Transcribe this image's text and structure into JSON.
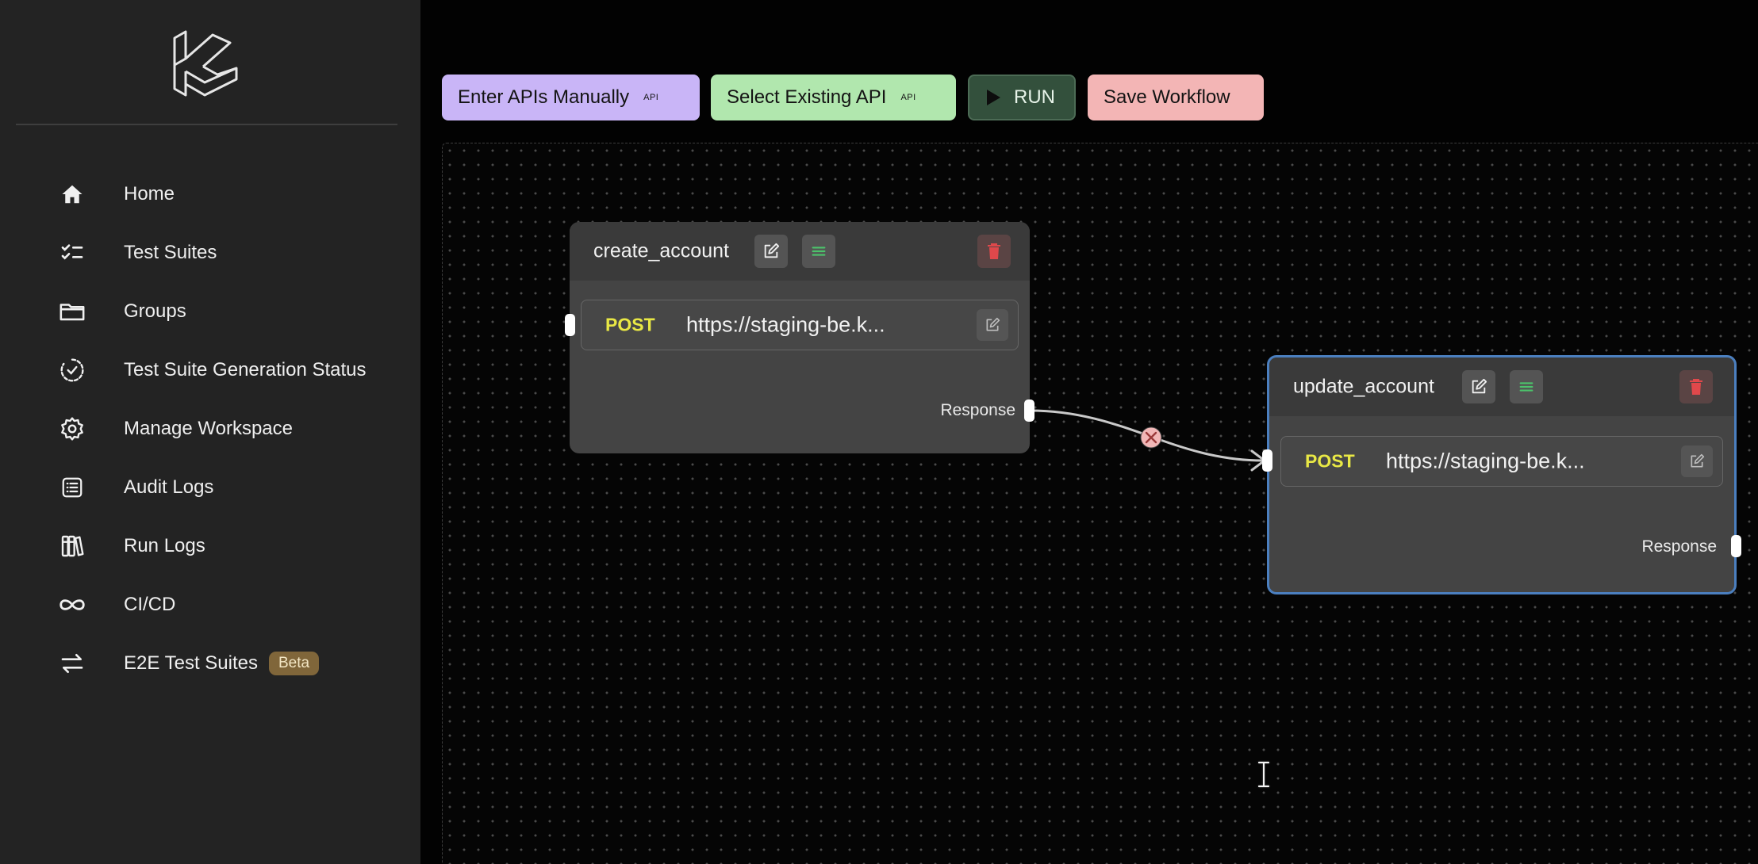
{
  "sidebar": {
    "logo": "kusho-logo",
    "items": [
      {
        "label": "Home",
        "icon": "home-icon"
      },
      {
        "label": "Test Suites",
        "icon": "checklist-icon"
      },
      {
        "label": "Groups",
        "icon": "folder-icon"
      },
      {
        "label": "Test Suite Generation Status",
        "icon": "status-check-icon"
      },
      {
        "label": "Manage Workspace",
        "icon": "gear-icon"
      },
      {
        "label": "Audit Logs",
        "icon": "list-icon"
      },
      {
        "label": "Run Logs",
        "icon": "books-icon"
      },
      {
        "label": "CI/CD",
        "icon": "infinity-icon"
      },
      {
        "label": "E2E Test Suites",
        "icon": "swap-arrows-icon",
        "badge": "Beta"
      }
    ]
  },
  "toolbar": {
    "enter_manual_label": "Enter APIs Manually",
    "select_existing_label": "Select Existing API",
    "api_tag": "API",
    "run_label": "RUN",
    "save_label": "Save Workflow"
  },
  "workflow": {
    "nodes": [
      {
        "title": "create_account",
        "method": "POST",
        "url": "https://staging-be.k...",
        "output_label": "Response"
      },
      {
        "title": "update_account",
        "method": "POST",
        "url": "https://staging-be.k...",
        "output_label": "Response",
        "selected": true
      }
    ]
  },
  "colors": {
    "sidebar_bg": "#232323",
    "canvas_bg": "#050505",
    "method": "#e9e845",
    "selected_border": "#4b7fbf",
    "beta_badge": "#80663a"
  }
}
